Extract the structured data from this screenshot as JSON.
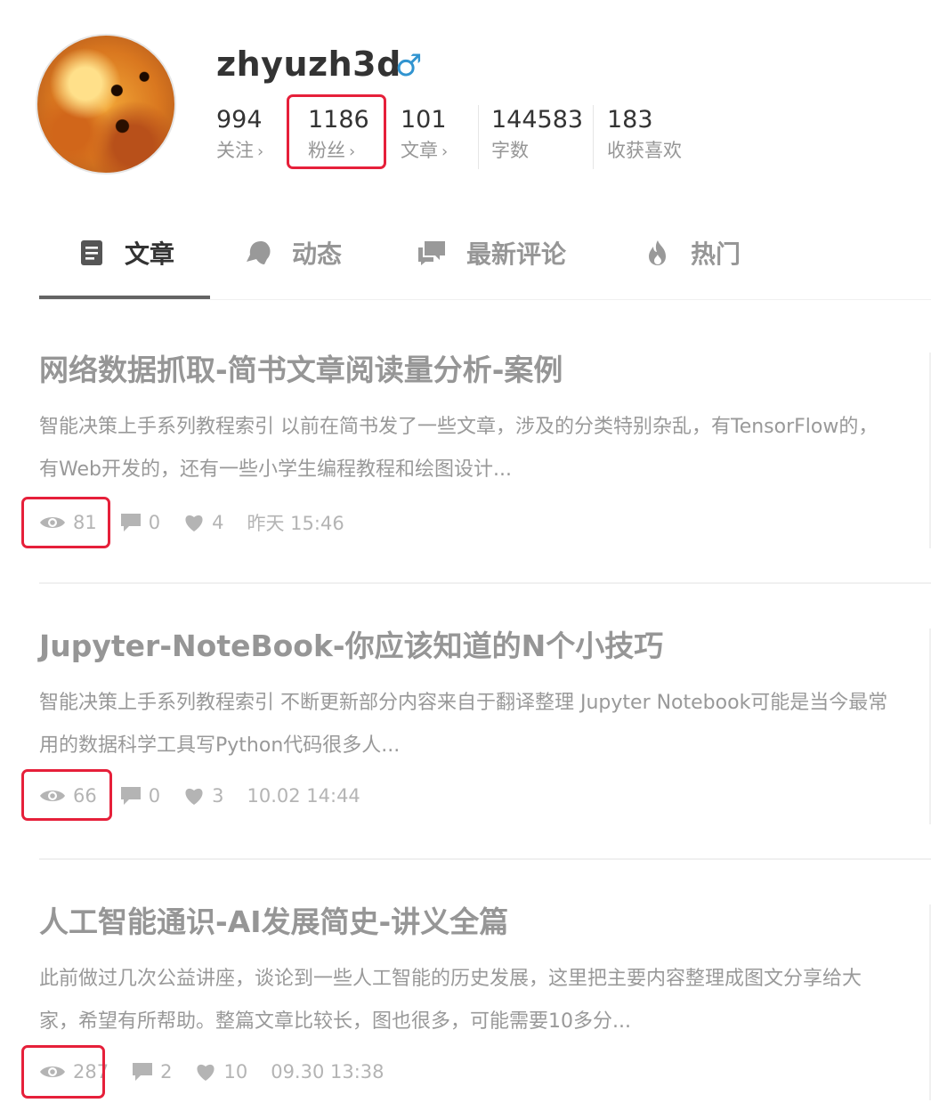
{
  "profile": {
    "username": "zhyuzh3d",
    "gender_icon": "♂",
    "stats": [
      {
        "value": "994",
        "label": "关注",
        "arrow": "›"
      },
      {
        "value": "1186",
        "label": "粉丝",
        "arrow": "›"
      },
      {
        "value": "101",
        "label": "文章",
        "arrow": "›"
      },
      {
        "value": "144583",
        "label": "字数",
        "arrow": ""
      },
      {
        "value": "183",
        "label": "收获喜欢",
        "arrow": ""
      }
    ]
  },
  "tabs": [
    {
      "label": "文章",
      "icon": "document-icon",
      "active": true
    },
    {
      "label": "动态",
      "icon": "bell-icon",
      "active": false
    },
    {
      "label": "最新评论",
      "icon": "comments-icon",
      "active": false
    },
    {
      "label": "热门",
      "icon": "fire-icon",
      "active": false
    }
  ],
  "articles": [
    {
      "title": "网络数据抓取-简书文章阅读量分析-案例",
      "abstract": "智能决策上手系列教程索引 以前在简书发了一些文章，涉及的分类特别杂乱，有TensorFlow的，有Web开发的，还有一些小学生编程教程和绘图设计...",
      "views": "81",
      "comments": "0",
      "likes": "4",
      "time": "昨天 15:46"
    },
    {
      "title": "Jupyter-NoteBook-你应该知道的N个小技巧",
      "abstract": "智能决策上手系列教程索引 不断更新部分内容来自于翻译整理 Jupyter Notebook可能是当今最常用的数据科学工具写Python代码很多人...",
      "views": "66",
      "comments": "0",
      "likes": "3",
      "time": "10.02 14:44"
    },
    {
      "title": "人工智能通识-AI发展简史-讲义全篇",
      "abstract": "此前做过几次公益讲座，谈论到一些人工智能的历史发展，这里把主要内容整理成图文分享给大家，希望有所帮助。整篇文章比较长，图也很多，可能需要10多分...",
      "views": "287",
      "comments": "2",
      "likes": "10",
      "time": "09.30 13:38"
    }
  ],
  "colors": {
    "highlight_box": "#e6203a",
    "accent": "#3194d0",
    "text_muted": "#969696"
  }
}
